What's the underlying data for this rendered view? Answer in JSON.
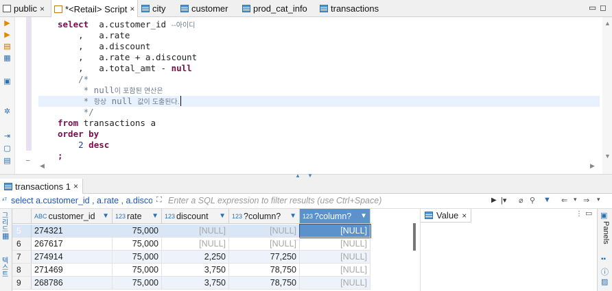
{
  "tabs": [
    {
      "label": "public",
      "icon": "document-icon",
      "closable": true
    },
    {
      "label": "*<Retail> Script",
      "icon": "sql-script-icon",
      "closable": true,
      "active": true
    },
    {
      "label": "city",
      "icon": "table-icon"
    },
    {
      "label": "customer",
      "icon": "table-icon"
    },
    {
      "label": "prod_cat_info",
      "icon": "table-icon"
    },
    {
      "label": "transactions",
      "icon": "table-icon"
    }
  ],
  "window": {
    "minimize": "▭",
    "maximize": "◻"
  },
  "editor": {
    "lines": [
      {
        "segments": [
          {
            "t": "select",
            "c": "kw"
          },
          {
            "t": "  a.customer_id ",
            "c": ""
          },
          {
            "t": "--아이디",
            "c": "cm-k"
          }
        ],
        "indent": 0
      },
      {
        "segments": [
          {
            "t": "    ,   a.rate",
            "c": ""
          }
        ],
        "indent": 0
      },
      {
        "segments": [
          {
            "t": "    ,   a.discount",
            "c": ""
          }
        ],
        "indent": 0
      },
      {
        "segments": [
          {
            "t": "    ,   a.rate + a.discount",
            "c": ""
          }
        ],
        "indent": 0
      },
      {
        "segments": [
          {
            "t": "    ,   a.total_amt - ",
            "c": ""
          },
          {
            "t": "null",
            "c": "kw"
          }
        ],
        "indent": 0
      },
      {
        "segments": [
          {
            "t": "    /*",
            "c": "cm"
          }
        ],
        "indent": 0
      },
      {
        "segments": [
          {
            "t": "     * null",
            "c": "cm"
          },
          {
            "t": "이 포함된 연산은",
            "c": "cm-k"
          }
        ],
        "indent": 0
      },
      {
        "segments": [
          {
            "t": "     * ",
            "c": "cm"
          },
          {
            "t": "항상",
            "c": "cm-k"
          },
          {
            "t": " null ",
            "c": "cm"
          },
          {
            "t": "값이 도출된다.",
            "c": "cm-k"
          }
        ],
        "indent": 0,
        "highlight": true
      },
      {
        "segments": [
          {
            "t": "     */",
            "c": "cm"
          }
        ],
        "indent": 0
      },
      {
        "segments": [
          {
            "t": "from",
            "c": "kw"
          },
          {
            "t": " transactions a",
            "c": ""
          }
        ],
        "indent": 0
      },
      {
        "segments": [
          {
            "t": "order by",
            "c": "kw"
          }
        ],
        "indent": 0
      },
      {
        "segments": [
          {
            "t": "    ",
            "c": ""
          },
          {
            "t": "2",
            "c": "num"
          },
          {
            "t": " ",
            "c": ""
          },
          {
            "t": "desc",
            "c": "kw"
          }
        ],
        "indent": 0
      },
      {
        "segments": [
          {
            "t": ";",
            "c": "kw"
          }
        ],
        "indent": 0
      }
    ]
  },
  "results": {
    "tab_label": "transactions 1",
    "query_text": "select a.customer_id , a.rate , a.discou",
    "filter_placeholder": "Enter a SQL expression to filter results (use Ctrl+Space)",
    "side_tabs": [
      "그리드",
      "텍스트"
    ],
    "columns": [
      {
        "label": "customer_id",
        "type": "ABC"
      },
      {
        "label": "rate",
        "type": "123"
      },
      {
        "label": "discount",
        "type": "123"
      },
      {
        "label": "?column?",
        "type": "123"
      },
      {
        "label": "?column?",
        "type": "123"
      }
    ],
    "rows": [
      {
        "num": "5",
        "cells": [
          "274321",
          "75,000",
          "[NULL]",
          "[NULL]",
          "[NULL]"
        ]
      },
      {
        "num": "6",
        "cells": [
          "267617",
          "75,000",
          "[NULL]",
          "[NULL]",
          "[NULL]"
        ]
      },
      {
        "num": "7",
        "cells": [
          "274914",
          "75,000",
          "2,250",
          "77,250",
          "[NULL]"
        ]
      },
      {
        "num": "8",
        "cells": [
          "271469",
          "75,000",
          "3,750",
          "78,750",
          "[NULL]"
        ]
      },
      {
        "num": "9",
        "cells": [
          "268786",
          "75,000",
          "3,750",
          "78,750",
          "[NULL]"
        ]
      }
    ],
    "value_panel_label": "Value",
    "panels_label": "Panels"
  }
}
